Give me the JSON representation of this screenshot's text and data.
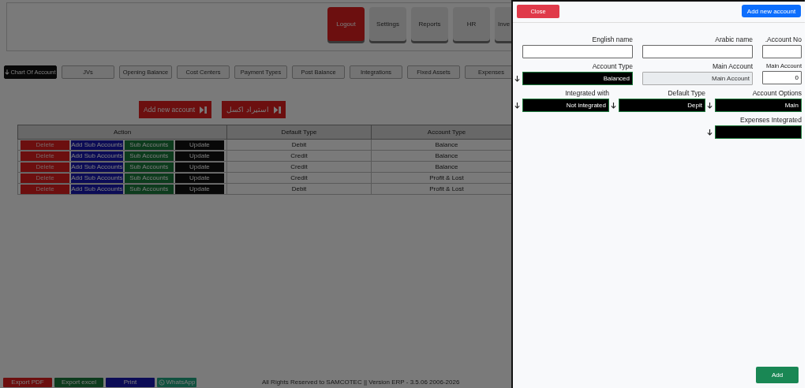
{
  "nav_buttons": [
    {
      "label": "Logout",
      "selected": true
    },
    {
      "label": "Settings",
      "selected": false
    },
    {
      "label": "Reports",
      "selected": false
    },
    {
      "label": "HR",
      "selected": false
    },
    {
      "label": "Inve",
      "selected": false
    }
  ],
  "tabs": [
    {
      "label": "Chart Of Account",
      "selected": true
    },
    {
      "label": "JVs",
      "selected": false
    },
    {
      "label": "Opening Balance",
      "selected": false
    },
    {
      "label": "Cost Centers",
      "selected": false
    },
    {
      "label": "Payment Types",
      "selected": false
    },
    {
      "label": "Post Balance",
      "selected": false
    },
    {
      "label": "Integrations",
      "selected": false
    },
    {
      "label": "Fixed Assets",
      "selected": false
    },
    {
      "label": "Expenses",
      "selected": false
    }
  ],
  "actions": [
    "Add new account",
    "استيراد اكسل"
  ],
  "table": {
    "columns": [
      "Action",
      "Default Type",
      "Account Type"
    ],
    "rows": [
      {
        "actions": [
          "Delete",
          "Add Sub Accounts",
          "Sub Accounts",
          "Update"
        ],
        "default_type": "Debit",
        "account_type": "Balance"
      },
      {
        "actions": [
          "Delete",
          "Add Sub Accounts",
          "Sub Accounts",
          "Update"
        ],
        "default_type": "Credit",
        "account_type": "Balance"
      },
      {
        "actions": [
          "Delete",
          "Add Sub Accounts",
          "Sub Accounts",
          "Update"
        ],
        "default_type": "Credit",
        "account_type": "Balance"
      },
      {
        "actions": [
          "Delete",
          "Add Sub Accounts",
          "Sub Accounts",
          "Update"
        ],
        "default_type": "Credit",
        "account_type": "Profit & Lost"
      },
      {
        "actions": [
          "Delete",
          "Add Sub Accounts",
          "Sub Accounts",
          "Update"
        ],
        "default_type": "Debit",
        "account_type": "Profit & Lost"
      }
    ]
  },
  "footer": {
    "buttons": [
      {
        "label": "Export PDF",
        "kind": "pdf"
      },
      {
        "label": "Export excel",
        "kind": "excel"
      },
      {
        "label": "Print",
        "kind": "print"
      },
      {
        "label": "WhatsApp",
        "kind": "whatsapp"
      }
    ],
    "copyright": "All Rights Reserved to SAMCOTEC || Version ERP - 3.5.06 2006-2026"
  },
  "panel": {
    "close_button": "Close",
    "add_new_button": "Add new account",
    "submit_button": "Add",
    "field_rows": [
      [
        {
          "label": "English name",
          "kind": "text"
        },
        {
          "label": "Arabic name",
          "kind": "text"
        },
        {
          "label": ".Account No",
          "kind": "text"
        }
      ],
      [
        {
          "label": "Account Type",
          "kind": "select",
          "value": "Balanced"
        },
        {
          "label": "Main Account",
          "kind": "disabled",
          "value": "Main Account"
        },
        {
          "label": "Main Account",
          "kind": "number",
          "value": "0"
        }
      ],
      [
        {
          "label": "Integrated with",
          "kind": "select",
          "value": "Not integrated"
        },
        {
          "label": "Default Type",
          "kind": "select",
          "value": "Depit"
        },
        {
          "label": "Account Options",
          "kind": "select",
          "value": "Main"
        }
      ],
      [
        {
          "label": "Expenses Integrated",
          "kind": "select"
        }
      ]
    ]
  }
}
